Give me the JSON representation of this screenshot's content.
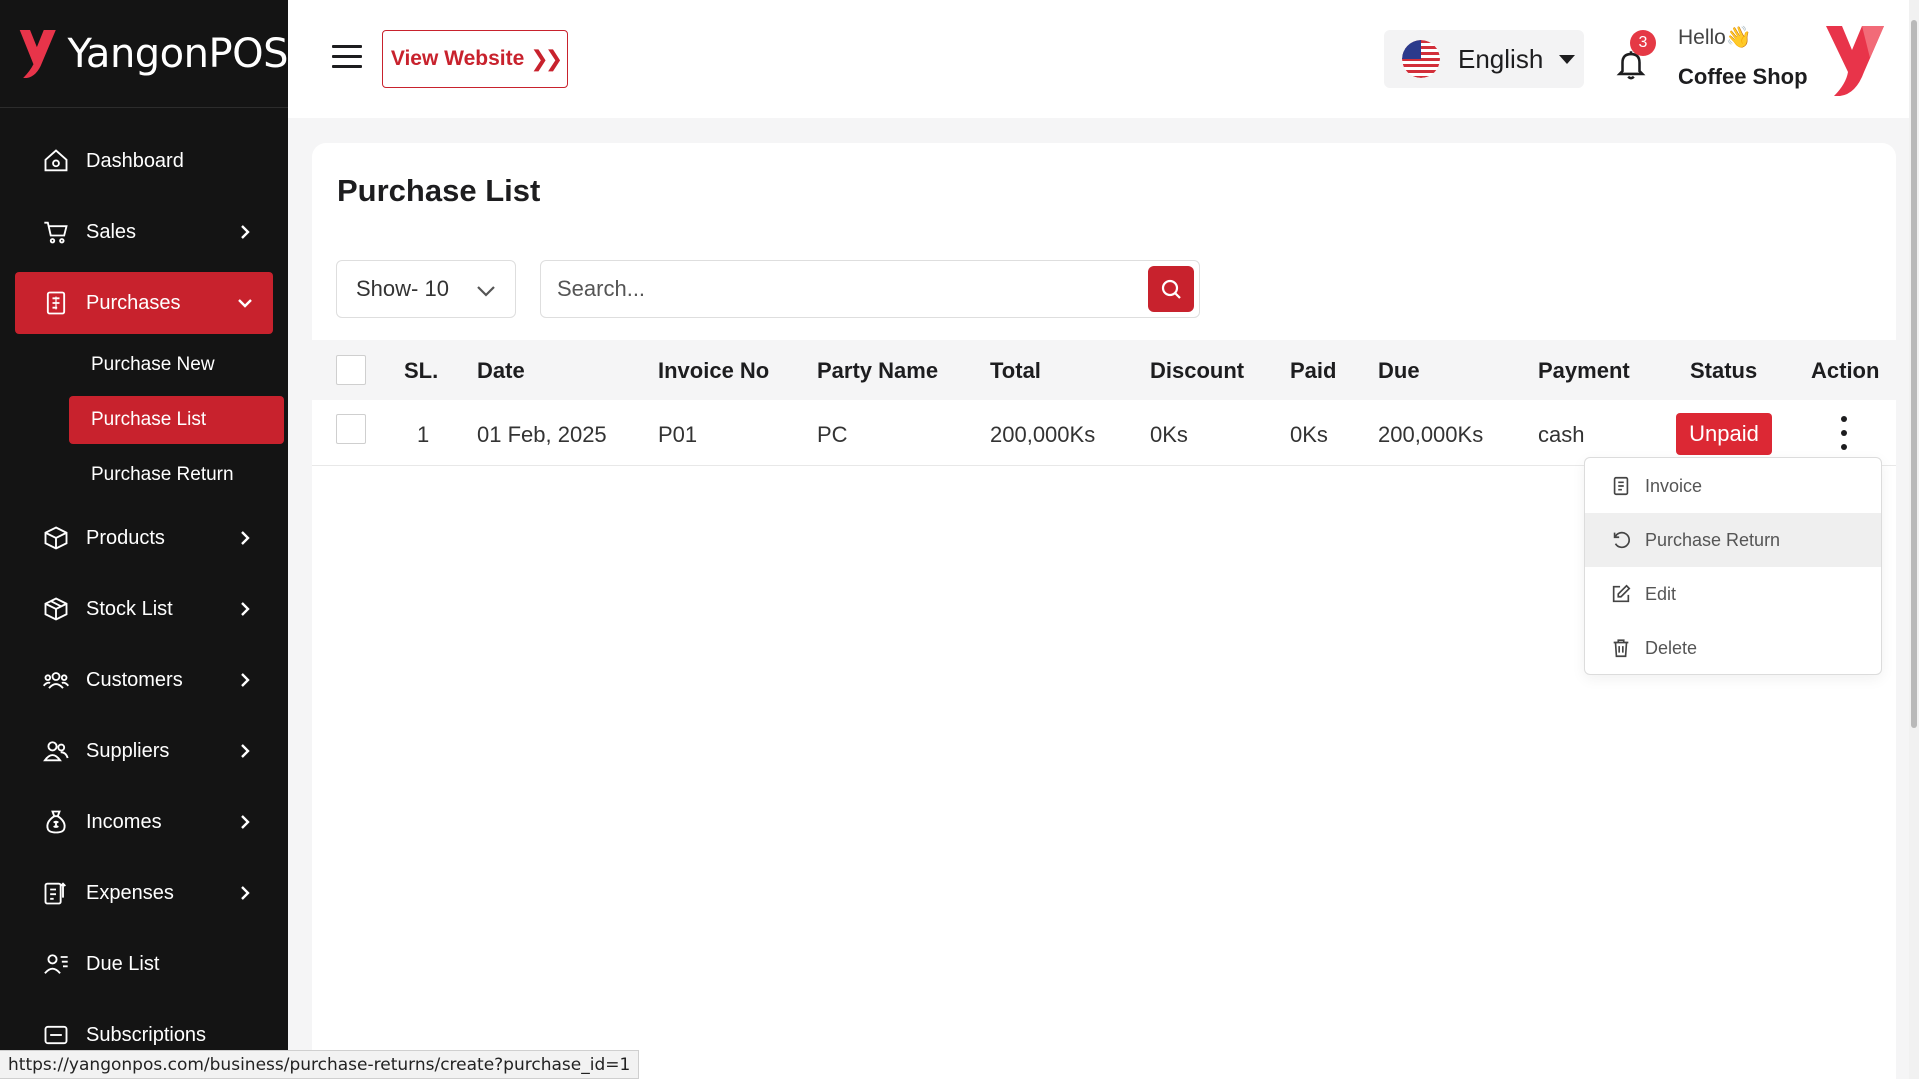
{
  "brand": {
    "name": "YangonPOS",
    "color": "#e8344a"
  },
  "colors": {
    "accent": "#c8222d",
    "sidebar_bg": "#141414",
    "badge": "#e53945"
  },
  "sidebar": {
    "items": [
      {
        "label": "Dashboard",
        "icon": "home-icon"
      },
      {
        "label": "Sales",
        "icon": "cart-icon"
      },
      {
        "label": "Purchases",
        "icon": "receipt-icon",
        "active": true,
        "expanded": true
      },
      {
        "label": "Products",
        "icon": "box-icon"
      },
      {
        "label": "Stock List",
        "icon": "package-icon"
      },
      {
        "label": "Customers",
        "icon": "users-icon"
      },
      {
        "label": "Suppliers",
        "icon": "supplier-icon"
      },
      {
        "label": "Incomes",
        "icon": "money-bag-icon"
      },
      {
        "label": "Expenses",
        "icon": "expense-icon"
      },
      {
        "label": "Due List",
        "icon": "user-list-icon"
      },
      {
        "label": "Subscriptions",
        "icon": "subscription-icon"
      }
    ],
    "purchases_sub": [
      {
        "label": "Purchase New"
      },
      {
        "label": "Purchase List",
        "active": true
      },
      {
        "label": "Purchase Return"
      }
    ]
  },
  "header": {
    "view_website": "View Website",
    "language": "English",
    "notification_count": "3",
    "greeting": "Hello👋",
    "shop_name": "Coffee Shop"
  },
  "page": {
    "title": "Purchase List",
    "show_select": "Show- 10",
    "search_placeholder": "Search..."
  },
  "table": {
    "headers": [
      "SL.",
      "Date",
      "Invoice No",
      "Party Name",
      "Total",
      "Discount",
      "Paid",
      "Due",
      "Payment",
      "Status",
      "Action"
    ],
    "rows": [
      {
        "sl": "1",
        "date": "01 Feb, 2025",
        "invoice": "P01",
        "party": "PC",
        "total": "200,000Ks",
        "discount": "0Ks",
        "paid": "0Ks",
        "due": "200,000Ks",
        "payment": "cash",
        "status": "Unpaid"
      }
    ]
  },
  "action_menu": {
    "items": [
      {
        "label": "Invoice",
        "icon": "invoice-icon"
      },
      {
        "label": "Purchase Return",
        "icon": "undo-icon"
      },
      {
        "label": "Edit",
        "icon": "edit-icon"
      },
      {
        "label": "Delete",
        "icon": "trash-icon"
      }
    ]
  },
  "status_bar": {
    "url": "https://yangonpos.com/business/purchase-returns/create?purchase_id=1"
  }
}
